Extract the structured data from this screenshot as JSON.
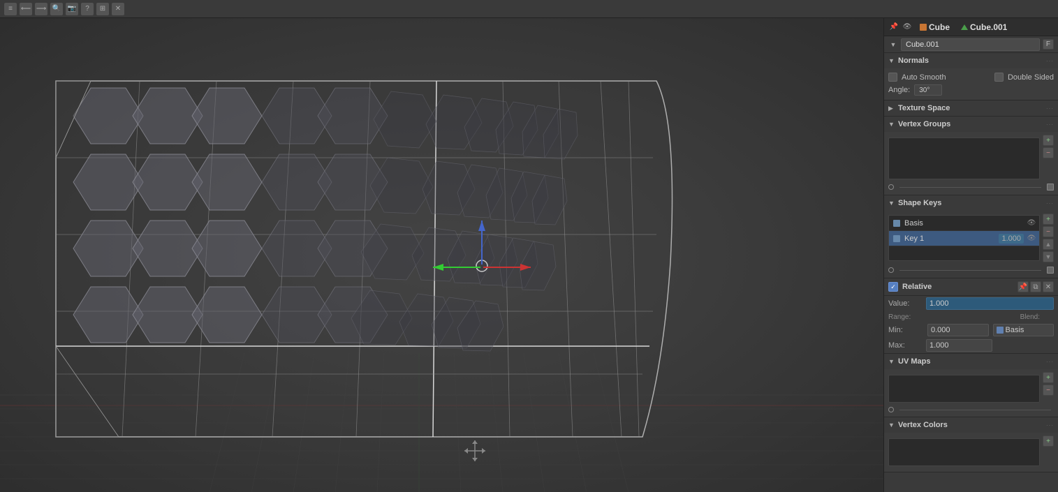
{
  "toolbar": {
    "icons": [
      "⊞",
      "⊡",
      "⧉",
      "⟳",
      "⬡",
      "✎",
      "🔗",
      "🏷",
      "⚙",
      "✕"
    ]
  },
  "header": {
    "object_icon": "cube",
    "object_name": "Cube",
    "mesh_icon": "triangle",
    "mesh_name": "Cube.001"
  },
  "datablock": {
    "filter_icon": "▼",
    "name": "Cube.001",
    "fake_user_btn": "F"
  },
  "panel_tabs": [
    "🔧",
    "📐",
    "🔵",
    "🔺",
    "⬜",
    "📷",
    "⚙",
    "🌐",
    "🧩",
    "✨",
    "🎨"
  ],
  "normals_section": {
    "title": "Normals",
    "auto_smooth_label": "Auto Smooth",
    "auto_smooth_checked": false,
    "double_sided_label": "Double Sided",
    "double_sided_checked": false,
    "angle_label": "Angle:",
    "angle_value": "30°"
  },
  "texture_space_section": {
    "title": "Texture Space",
    "collapsed": true
  },
  "vertex_groups_section": {
    "title": "Vertex Groups",
    "items": [],
    "buttons": {
      "circle": "○",
      "dash": "—",
      "pin": "📌"
    }
  },
  "shape_keys_section": {
    "title": "Shape Keys",
    "keys": [
      {
        "name": "Basis",
        "value": null,
        "selected": false
      },
      {
        "name": "Key 1",
        "value": "1.000",
        "selected": true
      }
    ],
    "buttons": {
      "plus": "+",
      "minus": "−",
      "up": "▲",
      "down": "▼",
      "more": "⋯"
    }
  },
  "relative_section": {
    "checkbox_label": "Relative",
    "checked": true,
    "value_label": "Value:",
    "value": "1.000",
    "range_label": "Range:",
    "blend_label": "Blend:",
    "min_label": "Min:",
    "min_value": "0.000",
    "max_label": "Max:",
    "max_value": "1.000",
    "blend_value": "Basis"
  },
  "uv_maps_section": {
    "title": "UV Maps",
    "items": []
  },
  "vertex_colors_section": {
    "title": "Vertex Colors",
    "items": []
  },
  "viewport": {
    "background_color": "#3d3d3d"
  }
}
